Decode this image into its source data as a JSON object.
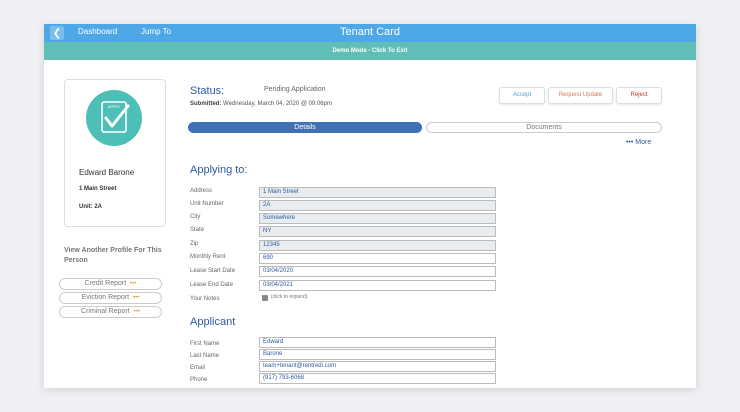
{
  "header": {
    "dashboard": "Dashboard",
    "jump_to": "Jump To",
    "title": "Tenant Card",
    "demo_mode": "Demo Mode - Click To Exit"
  },
  "profile": {
    "icon": "apply-checkmark-icon",
    "badge_text": "APPLY",
    "name": "Edward Barone",
    "address": "1 Main Street",
    "unit": "Unit: 2A"
  },
  "sidebar": {
    "view_another": "View Another Profile For This Person",
    "reports": [
      {
        "label": "Credit Report",
        "dots": "•••"
      },
      {
        "label": "Eviction Report",
        "dots": "•••"
      },
      {
        "label": "Criminal Report",
        "dots": "•••"
      }
    ]
  },
  "status": {
    "label": "Status:",
    "value": "Pending Application",
    "submitted_label": "Submitted:",
    "submitted_value": "Wednesday, March 04, 2020 @ 09:06pm"
  },
  "actions": {
    "accept": "Accept",
    "request_update": "Request Update",
    "reject": "Reject"
  },
  "tabs": {
    "details": "Details",
    "documents": "Documents"
  },
  "more": "••• More",
  "applying_to": {
    "title": "Applying to:",
    "fields": [
      {
        "label": "Address",
        "value": "1 Main Street"
      },
      {
        "label": "Unit Number",
        "value": "2A"
      },
      {
        "label": "City",
        "value": "Somewhere"
      },
      {
        "label": "State",
        "value": "NY"
      },
      {
        "label": "Zip",
        "value": "12345"
      },
      {
        "label": "Monthly Rent",
        "value": "690"
      },
      {
        "label": "Lease Start Date",
        "value": "03/04/2020"
      },
      {
        "label": "Lease End Date",
        "value": "03/04/2021"
      }
    ],
    "notes_label": "Your Notes",
    "notes_hint": "(click to expand)"
  },
  "applicant": {
    "title": "Applicant",
    "fields": [
      {
        "label": "First Name",
        "value": "Edward"
      },
      {
        "label": "Last Name",
        "value": "Barone"
      },
      {
        "label": "Email",
        "value": "team+tenant@rentredi.com"
      },
      {
        "label": "Phone",
        "value": "(917) 793-6068"
      }
    ]
  },
  "colors": {
    "header_blue": "#4ea8e8",
    "demo_teal": "#5fbfb6",
    "accent_blue": "#2c5aa0",
    "tab_active": "#4071b5"
  }
}
